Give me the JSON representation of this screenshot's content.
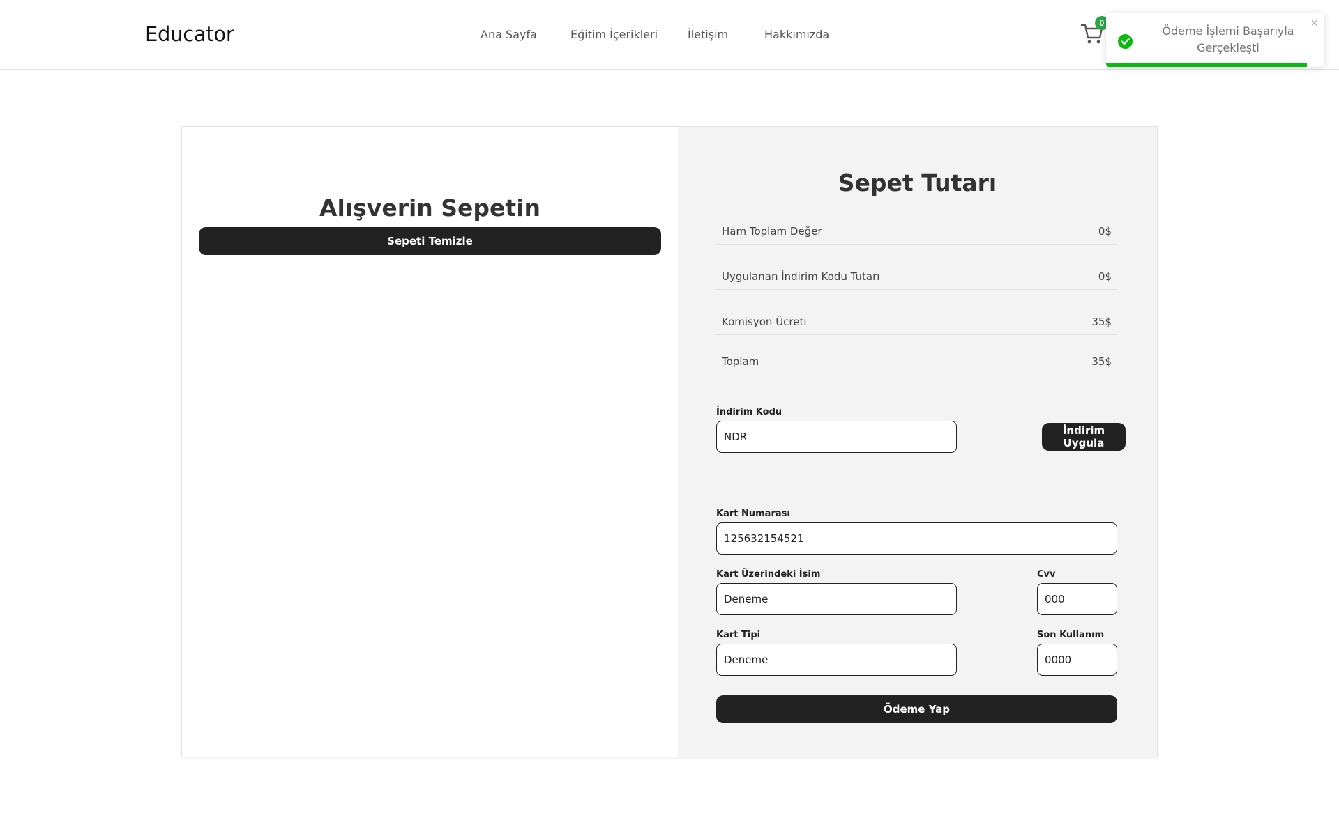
{
  "header": {
    "brand": "Educator",
    "nav": [
      "Ana Sayfa",
      "Eğitim İçerikleri",
      "İletişim",
      "Hakkımızda"
    ],
    "cart_count": "0"
  },
  "toast": {
    "message": "Ödeme İşlemi Başarıyla Gerçekleşti",
    "close": "×",
    "progress": 0.92,
    "color": "#07bc0c"
  },
  "cart": {
    "title": "Alışverin Sepetin",
    "clear_label": "Sepeti Temizle"
  },
  "summary": {
    "title": "Sepet Tutarı",
    "rows": [
      {
        "label": "Ham Toplam Değer",
        "value": "0$"
      },
      {
        "label": "Uygulanan İndirim Kodu Tutarı",
        "value": "0$"
      },
      {
        "label": "Komisyon Ücreti",
        "value": "35$"
      },
      {
        "label": "Toplam",
        "value": "35$"
      }
    ]
  },
  "discount": {
    "label": "İndirim Kodu",
    "value": "NDR",
    "apply_label": "İndirim Uygula"
  },
  "payment": {
    "card_number": {
      "label": "Kart Numarası",
      "value": "125632154521"
    },
    "card_name": {
      "label": "Kart Üzerindeki İsim",
      "value": "Deneme"
    },
    "cvv": {
      "label": "Cvv",
      "value": "000"
    },
    "card_type": {
      "label": "Kart Tipi",
      "value": "Deneme"
    },
    "expiry": {
      "label": "Son Kullanım",
      "value": "0000"
    },
    "pay_label": "Ödeme Yap"
  },
  "colors": {
    "dark": "#222222",
    "panel": "#f3f3f3",
    "success": "#07bc0c",
    "badge": "#28a745"
  },
  "icons": {
    "cart": "shopping-cart-icon",
    "success": "check-circle-icon",
    "close": "close-icon"
  }
}
